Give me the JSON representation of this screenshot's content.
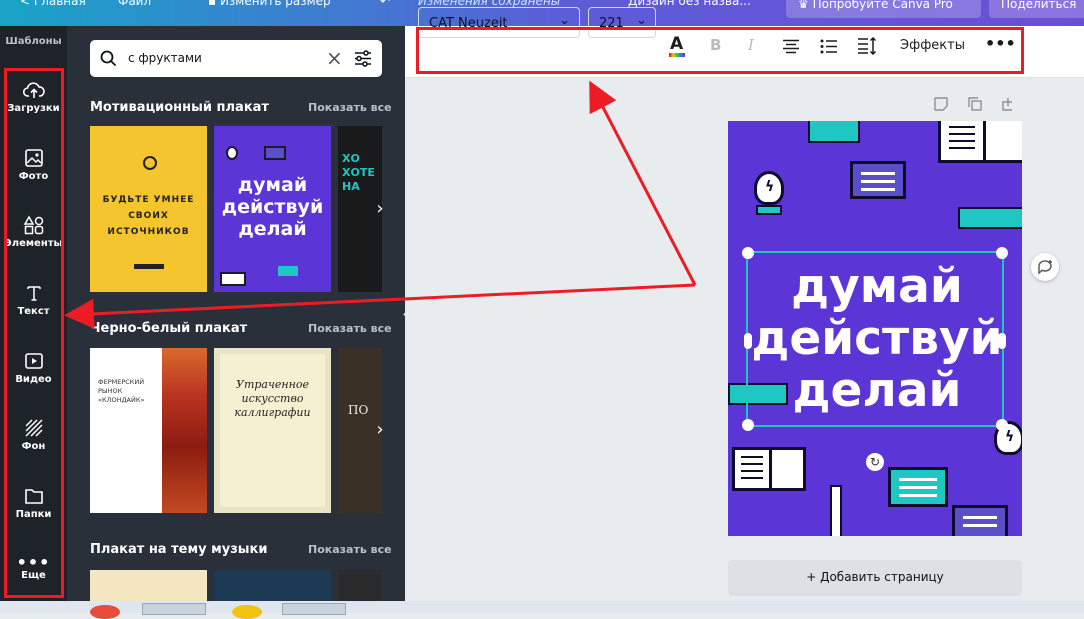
{
  "topbar": {
    "home": "Главная",
    "file": "Файл",
    "resize": "Изменить размер",
    "saved": "Изменения сохранены",
    "design_name": "Дизайн без назва...",
    "try_pro": "Попробуйте Canva Pro",
    "share": "Поделиться"
  },
  "nav": {
    "templates": "Шаблоны",
    "items": [
      {
        "label": "Загрузки",
        "icon": "upload-cloud-icon"
      },
      {
        "label": "Фото",
        "icon": "photo-icon"
      },
      {
        "label": "Элементы",
        "icon": "shapes-icon"
      },
      {
        "label": "Текст",
        "icon": "text-icon"
      },
      {
        "label": "Видео",
        "icon": "video-icon"
      },
      {
        "label": "Фон",
        "icon": "background-pattern-icon"
      },
      {
        "label": "Папки",
        "icon": "folder-icon"
      },
      {
        "label": "Еще",
        "icon": "more-dots-icon"
      }
    ]
  },
  "search": {
    "value": "с фруктами",
    "placeholder": "с фруктами"
  },
  "sections": [
    {
      "title": "Мотивационный плакат",
      "show_all": "Показать все",
      "thumbs": [
        {
          "text": "БУДЬТЕ УМНЕЕ\nСВОИХ\nИСТОЧНИКОВ",
          "bg": "#f4c52f"
        },
        {
          "text": "думай\nдействуй\nделай",
          "bg": "#5b35d6"
        },
        {
          "text": "ХО\nХОТЕ\nНА",
          "bg": "#1a1a1a"
        }
      ]
    },
    {
      "title": "Черно-белый плакат",
      "show_all": "Показать все",
      "thumbs": [
        {
          "text": "ФЕРМЕРСКИЙ\nРЫНОК\n«КЛОНДАЙК»",
          "bg": "#ffffff"
        },
        {
          "text": "Утраченное\nискусство\nкаллиграфии",
          "bg": "#f5f0d2"
        },
        {
          "text": "ПО",
          "bg": "#3a3026"
        }
      ]
    },
    {
      "title": "Плакат на тему музыки",
      "show_all": "Показать все"
    }
  ],
  "toolbar": {
    "font": "CAT Neuzeit",
    "size": "221",
    "effects": "Эффекты",
    "text_color": "#e8001c"
  },
  "poster": {
    "line1": "думай",
    "line2": "действуй",
    "line3": "делай",
    "bg": "#5b35d6",
    "accent": "#1ec7c1"
  },
  "add_page": "+ Добавить страницу",
  "colors": {
    "highlight": "#ed1c24",
    "sidebar": "#1e2229",
    "panel": "#293039"
  }
}
